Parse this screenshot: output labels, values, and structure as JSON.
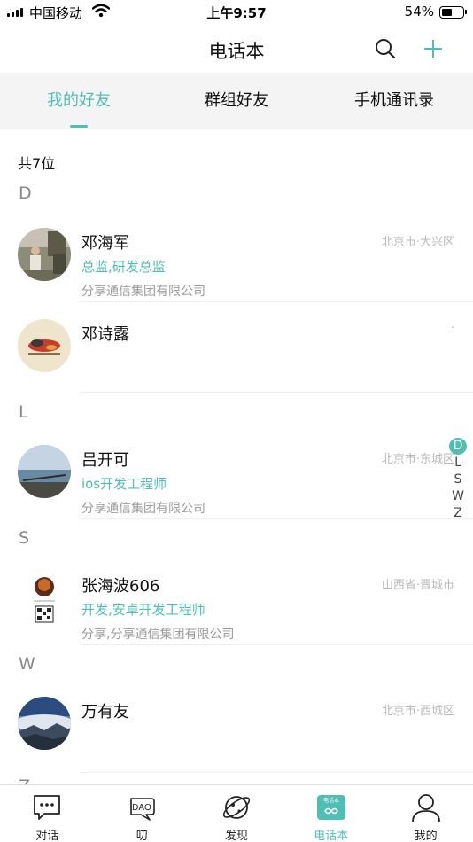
{
  "status_bar": {
    "carrier": "中国移动",
    "time": "上午9:57",
    "battery_percent": "54%",
    "battery_level": 0.54
  },
  "nav": {
    "title": "电话本",
    "search_icon": "search-icon",
    "add_icon": "plus-icon"
  },
  "tabs": [
    {
      "label": "我的好友",
      "active": true
    },
    {
      "label": "群组好友",
      "active": false
    },
    {
      "label": "手机通讯录",
      "active": false
    }
  ],
  "count_label": "共7位",
  "sections": [
    {
      "letter": "D"
    },
    {
      "letter": "L"
    },
    {
      "letter": "S"
    },
    {
      "letter": "W"
    },
    {
      "letter": "Z"
    }
  ],
  "contacts": [
    {
      "name": "邓海军",
      "title": "总监,研发总监",
      "company": "分享通信集团有限公司",
      "location": "北京市·大兴区"
    },
    {
      "name": "邓诗露",
      "title": "",
      "company": "",
      "location": "·"
    },
    {
      "name": "吕开可",
      "title": "ios开发工程师",
      "company": "分享通信集团有限公司",
      "location": "北京市·东城区"
    },
    {
      "name": "张海波606",
      "title": "开发,安卓开发工程师",
      "company": "分享,分享通信集团有限公司",
      "location": "山西省·晋城市"
    },
    {
      "name": "万有友",
      "title": "",
      "company": "",
      "location": "北京市·西城区"
    }
  ],
  "index_bar": [
    "D",
    "L",
    "S",
    "W",
    "Z"
  ],
  "index_active": "D",
  "tab_bar": [
    {
      "label": "对话",
      "icon": "chat-bubble-icon",
      "active": false
    },
    {
      "label": "叨",
      "icon": "dao-icon",
      "icon_text": "DAO",
      "active": false
    },
    {
      "label": "发现",
      "icon": "planet-icon",
      "active": false
    },
    {
      "label": "电话本",
      "icon": "phonebook-icon",
      "icon_text": "电话本",
      "active": true
    },
    {
      "label": "我的",
      "icon": "person-icon",
      "active": false
    }
  ],
  "colors": {
    "accent": "#4fbeb4",
    "muted_text": "#9a9a9a",
    "location_text": "#b9b9b9",
    "tab_background": "#f4f4f4"
  }
}
